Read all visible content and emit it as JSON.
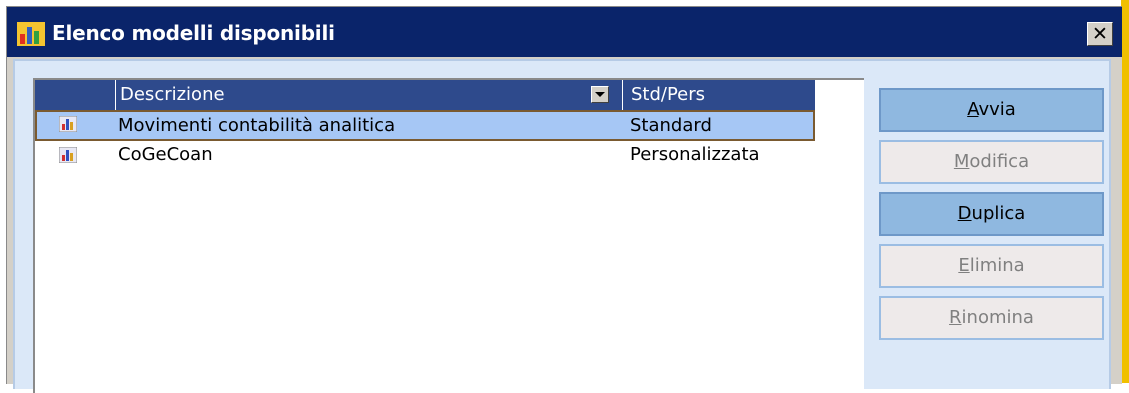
{
  "window": {
    "title": "Elenco modelli disponibili",
    "close_label": "✕"
  },
  "list": {
    "columns": [
      {
        "label": "Descrizione"
      },
      {
        "label": "Std/Pers"
      }
    ],
    "rows": [
      {
        "description": "Movimenti contabilità analitica",
        "type": "Standard",
        "selected": true
      },
      {
        "description": "CoGeCoan",
        "type": "Personalizzata",
        "selected": false
      }
    ]
  },
  "buttons": [
    {
      "first": "A",
      "rest": "vvia",
      "enabled": true
    },
    {
      "first": "M",
      "rest": "odifica",
      "enabled": false
    },
    {
      "first": "D",
      "rest": "uplica",
      "enabled": true
    },
    {
      "first": "E",
      "rest": "limina",
      "enabled": false
    },
    {
      "first": "R",
      "rest": "inomina",
      "enabled": false
    }
  ],
  "colors": {
    "titlebar": "#0a246a",
    "header": "#2e4a8c",
    "selection": "#a6c7f5",
    "panel": "#dbe8f8"
  }
}
